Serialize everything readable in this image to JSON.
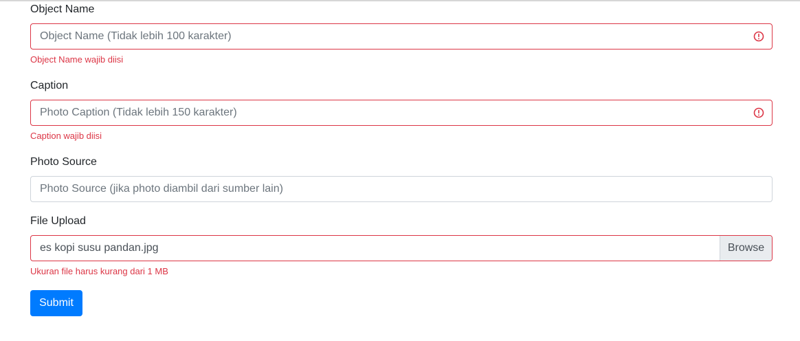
{
  "form": {
    "object_name": {
      "label": "Object Name",
      "placeholder": "Object Name (Tidak lebih 100 karakter)",
      "error": "Object Name wajib diisi"
    },
    "caption": {
      "label": "Caption",
      "placeholder": "Photo Caption (Tidak lebih 150 karakter)",
      "error": "Caption wajib diisi"
    },
    "photo_source": {
      "label": "Photo Source",
      "placeholder": "Photo Source (jika photo diambil dari sumber lain)"
    },
    "file_upload": {
      "label": "File Upload",
      "value": "es kopi susu pandan.jpg",
      "browse_label": "Browse",
      "error": "Ukuran file harus kurang dari 1 MB"
    },
    "submit_label": "Submit"
  },
  "colors": {
    "error": "#dc3545",
    "primary": "#007bff",
    "border": "#ced4da",
    "browse_bg": "#e9ecef"
  },
  "icons": {
    "invalid": "exclamation-circle-icon"
  }
}
